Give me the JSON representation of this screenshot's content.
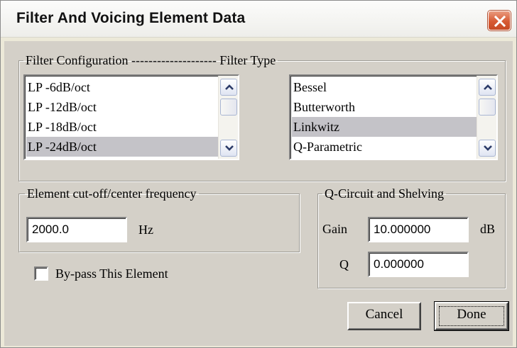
{
  "window": {
    "title": "Filter And Voicing Element Data",
    "close_icon": "close-x-icon"
  },
  "filter_config": {
    "legend": "Filter Configuration -------------------- Filter Type",
    "configurations": [
      "LP -6dB/oct",
      "LP -12dB/oct",
      "LP -18dB/oct",
      "LP -24dB/oct"
    ],
    "selected_configuration": "LP -24dB/oct",
    "types": [
      "Bessel",
      "Butterworth",
      "Linkwitz",
      "Q-Parametric"
    ],
    "selected_type": "Linkwitz",
    "scroll_up_icon": "chevron-up-icon",
    "scroll_down_icon": "chevron-down-icon"
  },
  "frequency": {
    "legend": "Element cut-off/center frequency",
    "value": "2000.0",
    "unit": "Hz"
  },
  "q_circuit": {
    "legend": "Q-Circuit and Shelving",
    "gain_label": "Gain",
    "gain_value": "10.000000",
    "gain_unit": "dB",
    "q_label": "Q",
    "q_value": "0.000000"
  },
  "bypass": {
    "label": "By-pass This Element",
    "checked": false
  },
  "buttons": {
    "cancel": "Cancel",
    "done": "Done"
  },
  "colors": {
    "selection": "#c4c3c8",
    "close_button": "#d75a33"
  }
}
